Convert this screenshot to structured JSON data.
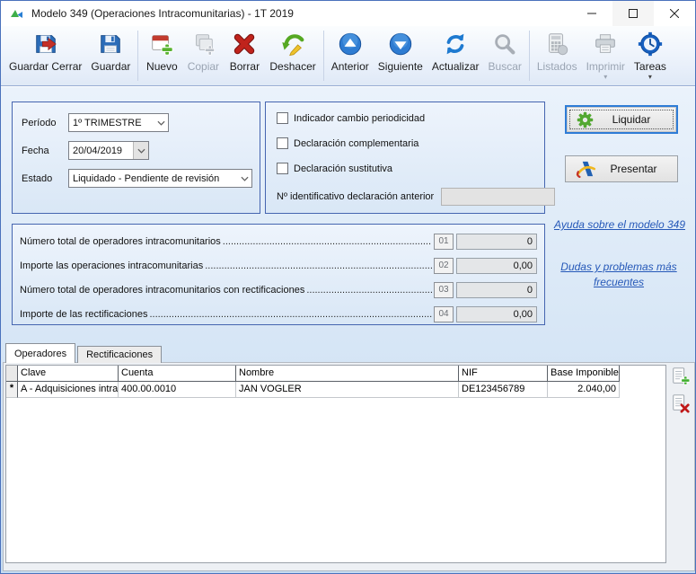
{
  "window": {
    "title": "Modelo 349 (Operaciones Intracomunitarias) - 1T 2019"
  },
  "toolbar": {
    "items": [
      {
        "label": "Guardar Cerrar",
        "icon": "save-close-icon",
        "enabled": true,
        "dropdown": false
      },
      {
        "label": "Guardar",
        "icon": "save-icon",
        "enabled": true,
        "dropdown": false
      },
      {
        "label": "Nuevo",
        "icon": "new-icon",
        "enabled": true,
        "dropdown": false
      },
      {
        "label": "Copiar",
        "icon": "copy-icon",
        "enabled": false,
        "dropdown": false
      },
      {
        "label": "Borrar",
        "icon": "delete-icon",
        "enabled": true,
        "dropdown": false
      },
      {
        "label": "Deshacer",
        "icon": "undo-icon",
        "enabled": true,
        "dropdown": false
      },
      {
        "label": "Anterior",
        "icon": "previous-icon",
        "enabled": true,
        "dropdown": false
      },
      {
        "label": "Siguiente",
        "icon": "next-icon",
        "enabled": true,
        "dropdown": false
      },
      {
        "label": "Actualizar",
        "icon": "refresh-icon",
        "enabled": true,
        "dropdown": false
      },
      {
        "label": "Buscar",
        "icon": "search-icon",
        "enabled": false,
        "dropdown": false
      },
      {
        "label": "Listados",
        "icon": "reports-icon",
        "enabled": false,
        "dropdown": false
      },
      {
        "label": "Imprimir",
        "icon": "print-icon",
        "enabled": false,
        "dropdown": true
      },
      {
        "label": "Tareas",
        "icon": "tasks-icon",
        "enabled": true,
        "dropdown": true
      }
    ]
  },
  "form": {
    "periodo_label": "Período",
    "periodo_value": "1º TRIMESTRE",
    "fecha_label": "Fecha",
    "fecha_value": "20/04/2019",
    "estado_label": "Estado",
    "estado_value": "Liquidado - Pendiente de revisión",
    "checkboxes": [
      "Indicador cambio periodicidad",
      "Declaración complementaria",
      "Declaración sustitutiva"
    ],
    "prev_decl_label": "Nº identificativo declaración anterior",
    "prev_decl_value": ""
  },
  "actions": {
    "liquidar": "Liquidar",
    "presentar": "Presentar"
  },
  "links": {
    "help": "Ayuda sobre el modelo 349",
    "faq": "Dudas y problemas más frecuentes"
  },
  "totals": {
    "rows": [
      {
        "code": "01",
        "label": "Número total de operadores intracomunitarios",
        "value": "0"
      },
      {
        "code": "02",
        "label": "Importe las operaciones intracomunitarias",
        "value": "0,00"
      },
      {
        "code": "03",
        "label": "Número total de operadores intracomunitarios con rectificaciones",
        "value": "0"
      },
      {
        "code": "04",
        "label": "Importe de las rectificaciones",
        "value": "0,00"
      }
    ]
  },
  "tabs": [
    {
      "label": "Operadores",
      "active": true
    },
    {
      "label": "Rectificaciones",
      "active": false
    }
  ],
  "grid": {
    "columns": [
      "Clave",
      "Cuenta",
      "Nombre",
      "NIF",
      "Base Imponible"
    ],
    "rows": [
      {
        "selector": "*",
        "clave": "A - Adquisiciones intrac",
        "cuenta": "400.00.0010",
        "nombre": "JAN VOGLER",
        "nif": "DE123456789",
        "base": "2.040,00"
      }
    ]
  },
  "colors": {
    "accent_focus": "#2e7cd6",
    "link": "#2558b8",
    "disabled_text": "#9aa4b2",
    "panel_border": "#4565b0",
    "add_green": "#4aa52e",
    "delete_red": "#b5211a"
  }
}
